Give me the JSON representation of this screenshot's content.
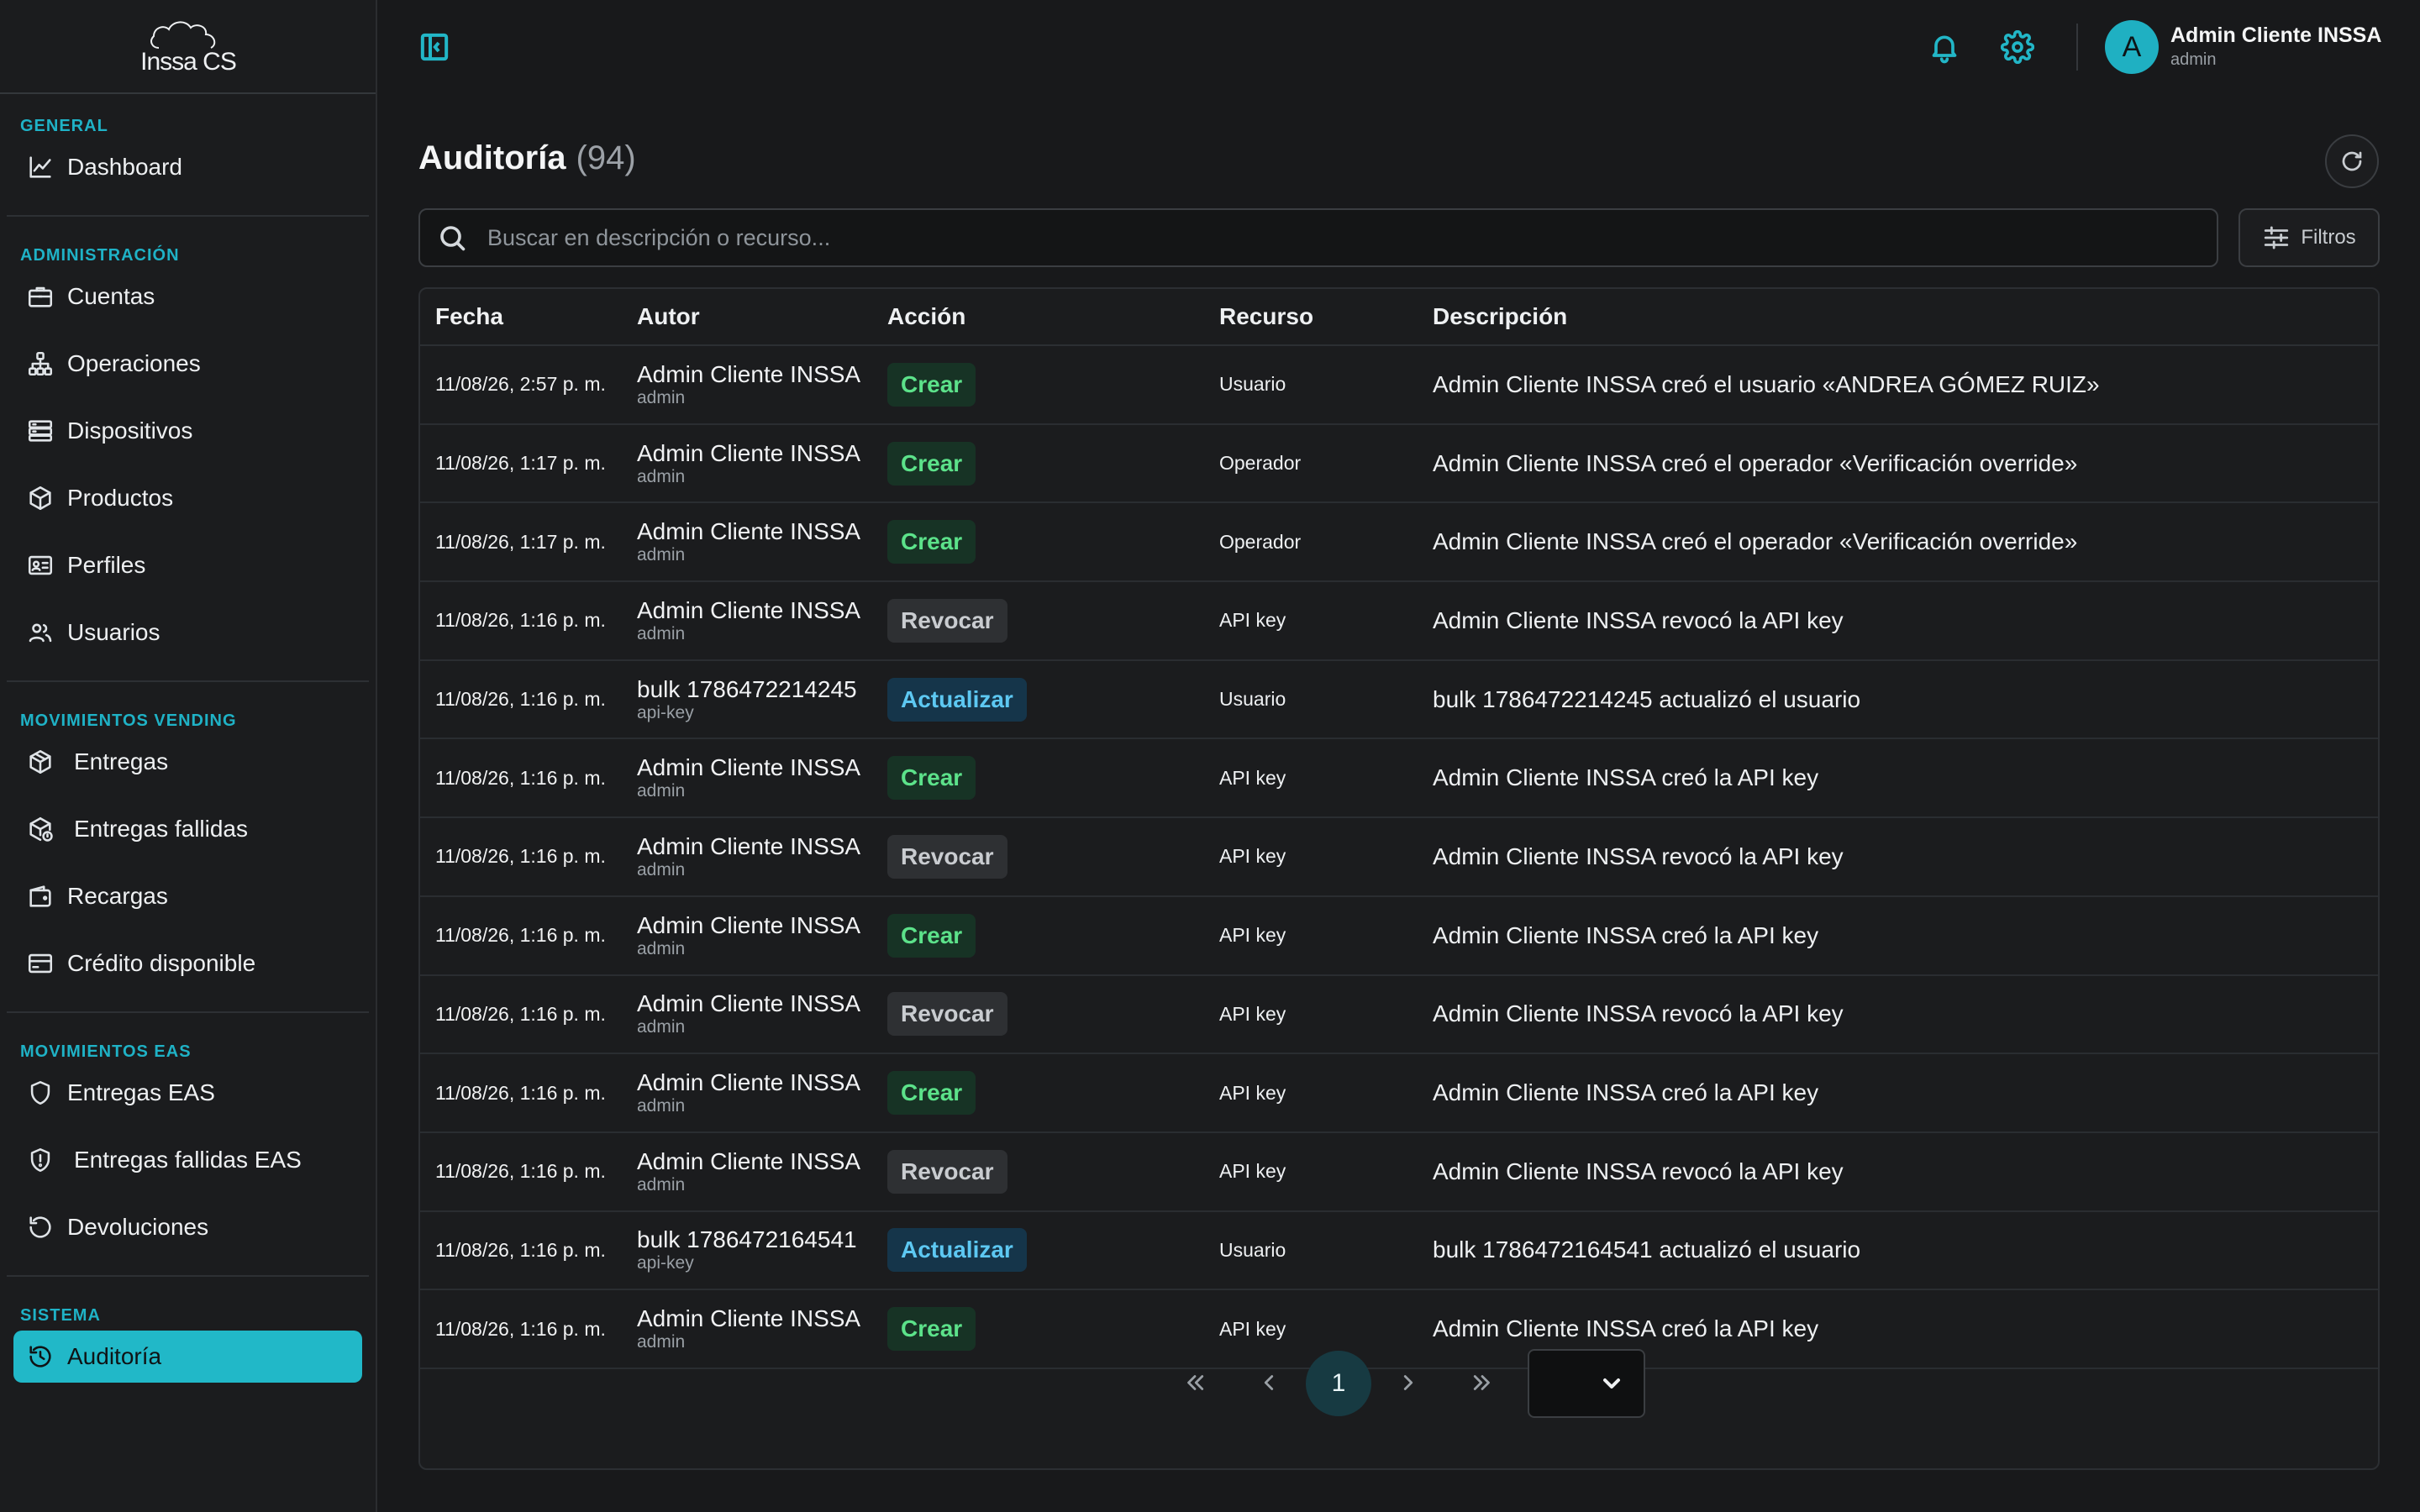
{
  "app": {
    "logo_text": "INSSA CS"
  },
  "sidebar": {
    "sections": [
      {
        "title": "GENERAL",
        "items": [
          {
            "label": "Dashboard",
            "icon": "chart-line-icon"
          }
        ]
      },
      {
        "title": "ADMINISTRACIÓN",
        "items": [
          {
            "label": "Cuentas",
            "icon": "briefcase-icon"
          },
          {
            "label": "Operaciones",
            "icon": "sitemap-icon"
          },
          {
            "label": "Dispositivos",
            "icon": "server-icon"
          },
          {
            "label": "Productos",
            "icon": "box-icon"
          },
          {
            "label": "Perfiles",
            "icon": "id-card-icon"
          },
          {
            "label": "Usuarios",
            "icon": "users-icon"
          }
        ]
      },
      {
        "title": "MOVIMIENTOS VENDING",
        "items": [
          {
            "label": "Entregas",
            "icon": "package-icon"
          },
          {
            "label": "Entregas fallidas",
            "icon": "package-alert-icon"
          },
          {
            "label": "Recargas",
            "icon": "wallet-icon"
          },
          {
            "label": "Crédito disponible",
            "icon": "credit-card-icon"
          }
        ]
      },
      {
        "title": "MOVIMIENTOS EAS",
        "items": [
          {
            "label": "Entregas EAS",
            "icon": "shield-icon"
          },
          {
            "label": "Entregas fallidas EAS",
            "icon": "shield-alert-icon"
          },
          {
            "label": "Devoluciones",
            "icon": "undo-icon"
          }
        ]
      },
      {
        "title": "SISTEMA",
        "items": [
          {
            "label": "Auditoría",
            "icon": "history-icon",
            "active": true
          }
        ]
      }
    ]
  },
  "header": {
    "user_name": "Admin Cliente INSSA",
    "user_role": "admin",
    "avatar_initial": "A"
  },
  "main": {
    "title": "Auditoría",
    "count": "(94)",
    "search_placeholder": "Buscar en descripción o recurso...",
    "filters_label": "Filtros",
    "columns": [
      "Fecha",
      "Autor",
      "Acción",
      "Recurso",
      "Descripción"
    ],
    "rows": [
      {
        "date": "11/08/26, 2:57 p. m.",
        "author": "Admin Cliente INSSA",
        "author_sub": "admin",
        "action": "Crear",
        "resource": "Usuario",
        "description": "Admin Cliente INSSA creó el usuario «ANDREA GÓMEZ RUIZ»"
      },
      {
        "date": "11/08/26, 1:17 p. m.",
        "author": "Admin Cliente INSSA",
        "author_sub": "admin",
        "action": "Crear",
        "resource": "Operador",
        "description": "Admin Cliente INSSA creó el operador «Verificación override»"
      },
      {
        "date": "11/08/26, 1:17 p. m.",
        "author": "Admin Cliente INSSA",
        "author_sub": "admin",
        "action": "Crear",
        "resource": "Operador",
        "description": "Admin Cliente INSSA creó el operador «Verificación override»"
      },
      {
        "date": "11/08/26, 1:16 p. m.",
        "author": "Admin Cliente INSSA",
        "author_sub": "admin",
        "action": "Revocar",
        "resource": "API key",
        "description": "Admin Cliente INSSA revocó la API key"
      },
      {
        "date": "11/08/26, 1:16 p. m.",
        "author": "bulk 1786472214245",
        "author_sub": "api-key",
        "action": "Actualizar",
        "resource": "Usuario",
        "description": "bulk 1786472214245 actualizó el usuario"
      },
      {
        "date": "11/08/26, 1:16 p. m.",
        "author": "Admin Cliente INSSA",
        "author_sub": "admin",
        "action": "Crear",
        "resource": "API key",
        "description": "Admin Cliente INSSA creó la API key"
      },
      {
        "date": "11/08/26, 1:16 p. m.",
        "author": "Admin Cliente INSSA",
        "author_sub": "admin",
        "action": "Revocar",
        "resource": "API key",
        "description": "Admin Cliente INSSA revocó la API key"
      },
      {
        "date": "11/08/26, 1:16 p. m.",
        "author": "Admin Cliente INSSA",
        "author_sub": "admin",
        "action": "Crear",
        "resource": "API key",
        "description": "Admin Cliente INSSA creó la API key"
      },
      {
        "date": "11/08/26, 1:16 p. m.",
        "author": "Admin Cliente INSSA",
        "author_sub": "admin",
        "action": "Revocar",
        "resource": "API key",
        "description": "Admin Cliente INSSA revocó la API key"
      },
      {
        "date": "11/08/26, 1:16 p. m.",
        "author": "Admin Cliente INSSA",
        "author_sub": "admin",
        "action": "Crear",
        "resource": "API key",
        "description": "Admin Cliente INSSA creó la API key"
      },
      {
        "date": "11/08/26, 1:16 p. m.",
        "author": "Admin Cliente INSSA",
        "author_sub": "admin",
        "action": "Revocar",
        "resource": "API key",
        "description": "Admin Cliente INSSA revocó la API key"
      },
      {
        "date": "11/08/26, 1:16 p. m.",
        "author": "bulk 1786472164541",
        "author_sub": "api-key",
        "action": "Actualizar",
        "resource": "Usuario",
        "description": "bulk 1786472164541 actualizó el usuario"
      },
      {
        "date": "11/08/26, 1:16 p. m.",
        "author": "Admin Cliente INSSA",
        "author_sub": "admin",
        "action": "Crear",
        "resource": "API key",
        "description": "Admin Cliente INSSA creó la API key"
      }
    ],
    "pagination": {
      "current_page": "1",
      "page_size": ""
    }
  },
  "colors": {
    "accent": "#21b8c8",
    "badge_crear": "#5ce28a",
    "badge_revocar": "#c9ccd0",
    "badge_actualizar": "#5dc8f2"
  }
}
